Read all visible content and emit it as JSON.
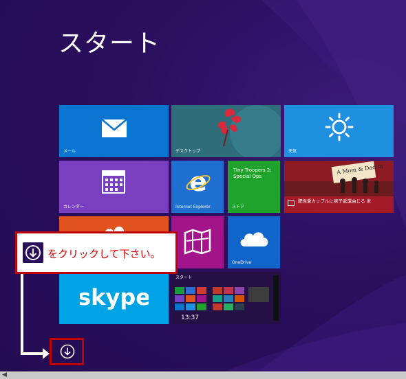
{
  "screen": {
    "title": "スタート"
  },
  "tiles": {
    "mail": "メール",
    "desktop": "デスクトップ",
    "weather": "天気",
    "calendar": "カレンダー",
    "ie": "Internet Explorer",
    "store_title": "Tiny Troopers 2: Special Ops",
    "store": "ストア",
    "news_caption": "肥性愛カップルに男子返還由じる 米",
    "news_sign": "A Mom & Dad in",
    "onedrive": "OneDrive",
    "skype_logo": "skype",
    "start_preview_title": "スタート",
    "start_preview_time": "13:37"
  },
  "callout": {
    "text": "をクリックして下さい。"
  },
  "colors": {
    "background": "#2a0f5e",
    "callout_border": "#c00000",
    "callout_text": "#e00000"
  }
}
